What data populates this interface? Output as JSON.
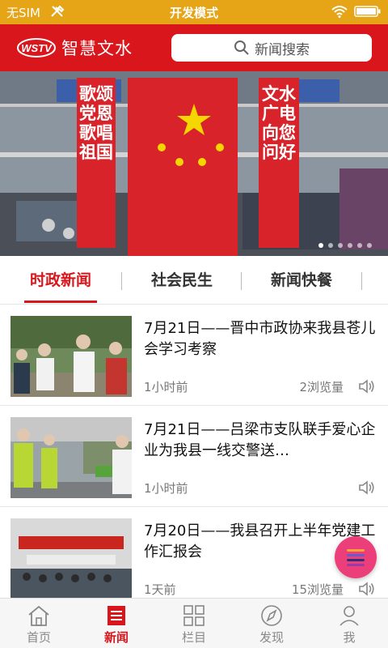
{
  "status_bar": {
    "carrier": "无SIM",
    "mode": "开发模式",
    "icons": [
      "tools-icon",
      "wifi-icon",
      "battery-icon"
    ]
  },
  "header": {
    "app_name": "智慧文水",
    "logo_text": "WSTV",
    "search_placeholder": "新闻搜索"
  },
  "banner": {
    "left_banner": "歌颂党恩 歌唱祖国",
    "right_banner": "文水广电 向您问好",
    "slide_count": 6,
    "active_slide": 0
  },
  "tabs": [
    {
      "label": "时政新闻",
      "active": true
    },
    {
      "label": "社会民生",
      "active": false
    },
    {
      "label": "新闻快餐",
      "active": false
    }
  ],
  "news": [
    {
      "title": "7月21日——晋中市政协来我县苍儿会学习考察",
      "time": "1小时前",
      "views": "2浏览量"
    },
    {
      "title": "7月21日——吕梁市支队联手爱心企业为我县一线交警送…",
      "time": "1小时前",
      "views": ""
    },
    {
      "title": "7月20日——我县召开上半年党建工作汇报会",
      "time": "1天前",
      "views": "15浏览量"
    }
  ],
  "colors": {
    "brand_red": "#d9161c",
    "status_orange": "#e6a417",
    "fab_pink": "#ec3f7a"
  },
  "bottom_nav": [
    {
      "label": "首页",
      "icon": "home-icon",
      "active": false
    },
    {
      "label": "新闻",
      "icon": "news-icon",
      "active": true
    },
    {
      "label": "栏目",
      "icon": "grid-icon",
      "active": false
    },
    {
      "label": "发现",
      "icon": "compass-icon",
      "active": false
    },
    {
      "label": "我",
      "icon": "user-icon",
      "active": false
    }
  ]
}
